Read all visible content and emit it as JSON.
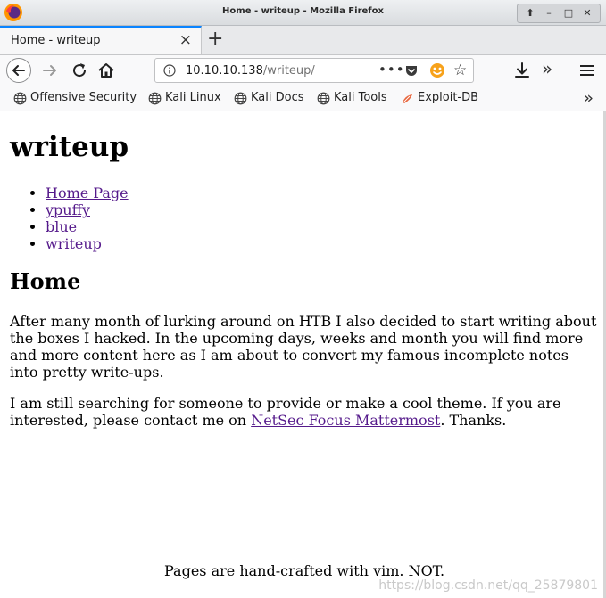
{
  "window": {
    "title": "Home - writeup - Mozilla Firefox"
  },
  "tab": {
    "title": "Home - writeup",
    "close": "×",
    "new_tab": "+"
  },
  "toolbar": {
    "url_host": "10.10.10.138",
    "url_path": "/writeup/",
    "page_actions": "•••",
    "star": "☆",
    "overflow": "»"
  },
  "bookmarks": {
    "items": [
      {
        "label": "Offensive Security",
        "icon": "globe-icon"
      },
      {
        "label": "Kali Linux",
        "icon": "globe-icon"
      },
      {
        "label": "Kali Docs",
        "icon": "globe-icon"
      },
      {
        "label": "Kali Tools",
        "icon": "globe-icon"
      },
      {
        "label": "Exploit-DB",
        "icon": "exploit-db-icon"
      }
    ],
    "more": "»"
  },
  "page": {
    "title": "writeup",
    "nav": [
      "Home Page",
      "ypuffy",
      "blue",
      "writeup"
    ],
    "section_title": "Home",
    "paragraph1": "After many month of lurking around on HTB I also decided to start writing about the boxes I hacked. In the upcoming days, weeks and month you will find more and more content here as I am about to convert my famous incomplete notes into pretty write-ups.",
    "paragraph2_before": "I am still searching for someone to provide or make a cool theme. If you are interested, please contact me on ",
    "paragraph2_link": "NetSec Focus Mattermost",
    "paragraph2_after": ". Thanks.",
    "footer": "Pages are hand-crafted with vim. NOT."
  },
  "watermark": "https://blog.csdn.net/qq_25879801",
  "colors": {
    "accent": "#0a84ff",
    "visited_link": "#551a8b"
  }
}
